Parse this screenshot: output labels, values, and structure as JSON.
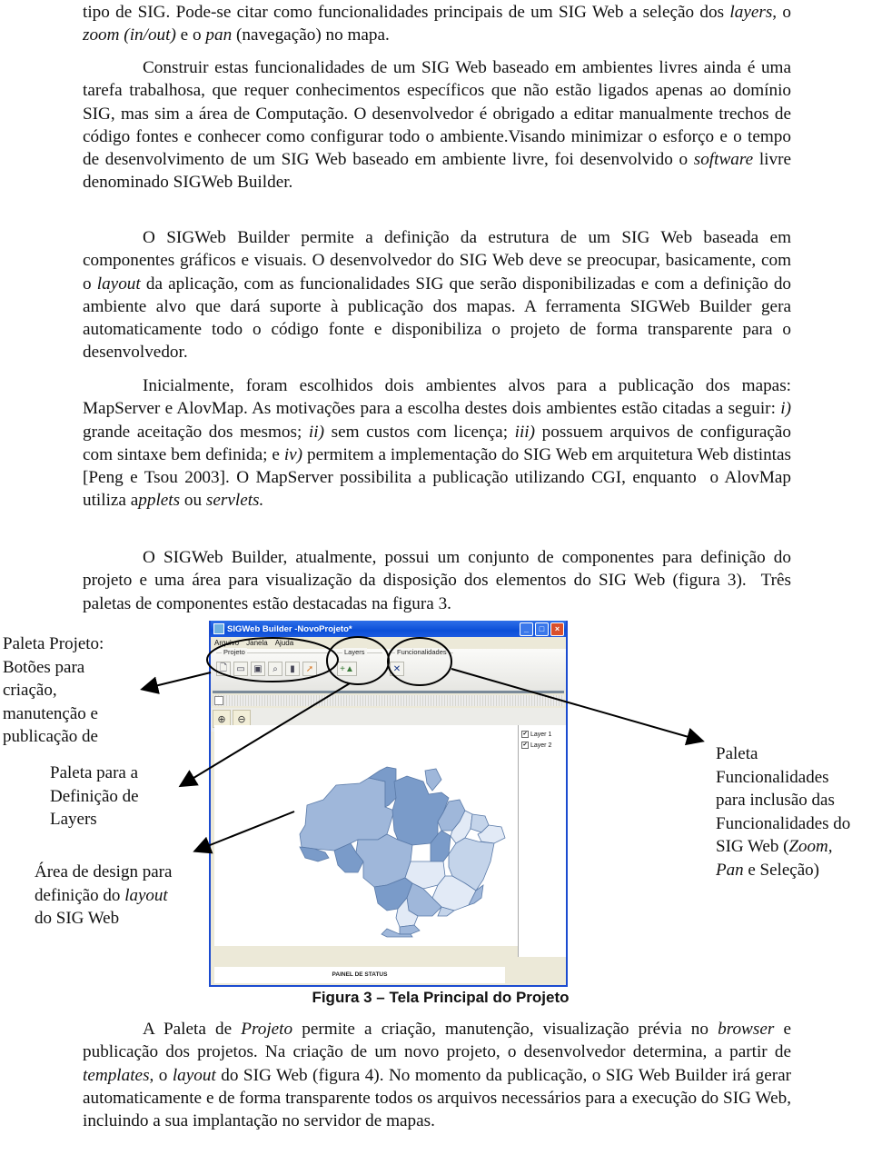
{
  "paragraphs": [
    {
      "html": "tipo de SIG. Pode-se citar como funcionalidades principais de um SIG Web a seleção dos <i>layers</i>, o <i>zoom (in/out)</i> e o <i>pan</i> (navegação) no mapa."
    },
    {
      "html": "Construir estas funcionalidades de um SIG Web baseado em ambientes livres ainda é uma tarefa trabalhosa, que requer conhecimentos específicos que não estão ligados apenas ao domínio SIG, mas sim a área de Computação. O desenvolvedor é obrigado a editar manualmente trechos de código fontes e conhecer como configurar todo o ambiente.Visando minimizar o esforço e o tempo de desenvolvimento de um SIG Web baseado em ambiente livre, foi desenvolvido o <i>software</i> livre denominado SIGWeb Builder."
    },
    {
      "html": "O SIGWeb Builder permite a definição da estrutura de um SIG Web baseada em componentes gráficos e visuais. O desenvolvedor do SIG Web deve se preocupar, basicamente, com o <i>layout</i> da aplicação, com as funcionalidades SIG que serão disponibilizadas e com a definição do ambiente alvo que dará suporte à publicação dos mapas. A ferramenta SIGWeb Builder gera automaticamente todo o código fonte e disponibiliza o projeto de forma transparente para o desenvolvedor."
    },
    {
      "html": "Inicialmente, foram escolhidos dois ambientes alvos para a publicação dos mapas: MapServer e AlovMap. As motivações para a escolha destes dois ambientes estão citadas a seguir: <i>i)</i> grande aceitação dos mesmos; <i>ii)</i> sem custos com licença; <i>iii)</i> possuem arquivos de configuração com sintaxe bem definida; e <i>iv)</i> permitem a implementação do SIG Web em arquitetura Web distintas [Peng e Tsou 2003]. O MapServer possibilita a publicação utilizando CGI, enquanto&nbsp; o AlovMap utiliza a<i>pplets</i> ou <i>servlets.</i>"
    },
    {
      "html": "O SIGWeb Builder, atualmente, possui um conjunto de componentes para definição do projeto e uma área para visualização da disposição dos elementos do SIG Web (figura 3).&nbsp; Três paletas de componentes estão destacadas na figura 3."
    },
    {
      "html": "A Paleta de <i>Projeto</i> permite a criação, manutenção, visualização prévia no <i>browser</i> e publicação dos projetos. Na criação de um novo projeto, o desenvolvedor determina, a partir de <i>templates</i>, o <i>layout</i> do SIG Web (figura 4). No momento da publicação, o SIG Web Builder irá gerar automaticamente e de forma transparente todos os arquivos necessários para a execução do SIG Web, incluindo a sua implantação no servidor de mapas."
    }
  ],
  "annotations": {
    "projeto": "Paleta Projeto:<br>Botões para<br>criação,<br>manutenção e<br>publicação de",
    "layers": "Paleta para a<br>Definição de<br>Layers",
    "design": "Área de design para<br>definição do <i>layout</i><br>do SIG Web",
    "funcionalidades": "Paleta<br>Funcionalidades<br>para inclusão das<br>Funcionalidades do<br>SIG Web (<i>Zoom,</i><br><i>Pan</i> e Seleção)"
  },
  "figure": {
    "caption": "Figura 3 – Tela Principal do Projeto",
    "window_title": "SIGWeb Builder -NovoProjeto*",
    "window_buttons": {
      "minimize": "_",
      "maximize": "□",
      "close": "×"
    },
    "menu": [
      "Arquivo",
      "Janela",
      "Ajuda"
    ],
    "palettes": [
      {
        "title": "Projeto",
        "buttons": [
          "new-file",
          "open-folder",
          "save",
          "preview",
          "database",
          "publish"
        ]
      },
      {
        "title": "Layers",
        "buttons": [
          "add-layer"
        ]
      },
      {
        "title": "Funcionalidades",
        "buttons": [
          "tools"
        ]
      }
    ],
    "zoom_buttons": {
      "in": "⊕",
      "out": "⊖"
    },
    "layers": [
      {
        "name": "Layer 1",
        "checked": true
      },
      {
        "name": "Layer 2",
        "checked": true
      }
    ],
    "status_panel": "PAINEL DE STATUS",
    "map_colors": {
      "dark": "#7a9bc9",
      "mid": "#9fb7da",
      "light": "#c4d4ea",
      "pale": "#e2eaf6"
    }
  }
}
